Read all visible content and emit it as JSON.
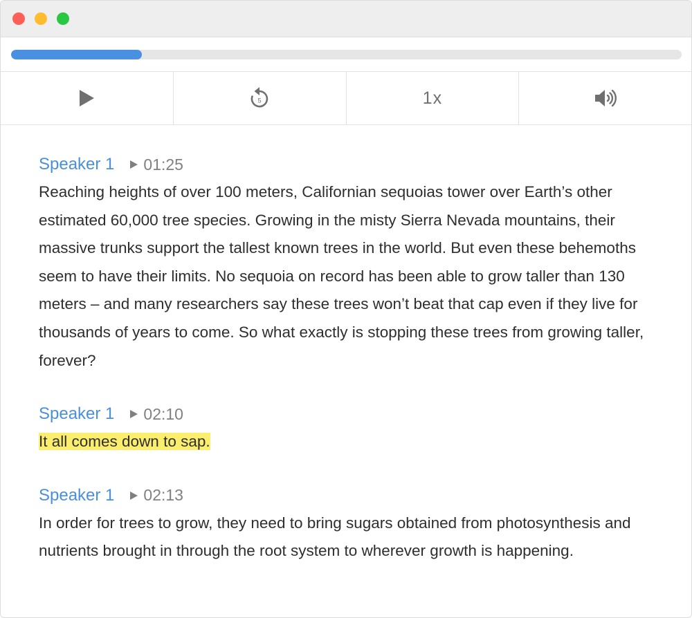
{
  "colors": {
    "accent": "#4a90d9",
    "progress_fill": "#4a90e2",
    "highlight": "#fcee6d",
    "traffic_red": "#fe5f57",
    "traffic_yellow": "#febc2e",
    "traffic_green": "#28c840"
  },
  "player": {
    "progress": 0.195,
    "controls": {
      "play_icon": "play-icon",
      "rewind_icon": "rewind-5-icon",
      "rewind_seconds": "5",
      "speed_label": "1x",
      "volume_icon": "volume-icon"
    }
  },
  "transcript": [
    {
      "speaker": "Speaker 1",
      "timestamp": "01:25",
      "text": "Reaching heights of over 100 meters, Californian sequoias tower over Earth’s other estimated 60,000 tree species. Growing in the misty Sierra Nevada mountains, their massive trunks support the tallest known trees in the world. But even these behemoths seem to have their limits. No sequoia on record has been able to grow taller than 130 meters – and many researchers say these trees won’t beat that cap even if they live for thousands of years to come. So what exactly is stopping these trees from growing taller, forever?",
      "highlighted": false
    },
    {
      "speaker": "Speaker 1",
      "timestamp": "02:10",
      "text": "It all comes down to sap.",
      "highlighted": true
    },
    {
      "speaker": "Speaker 1",
      "timestamp": "02:13",
      "text": "In order for trees to grow, they need to bring sugars obtained from photosynthesis and nutrients brought in through the root system to wherever growth is happening.",
      "highlighted": false
    }
  ]
}
